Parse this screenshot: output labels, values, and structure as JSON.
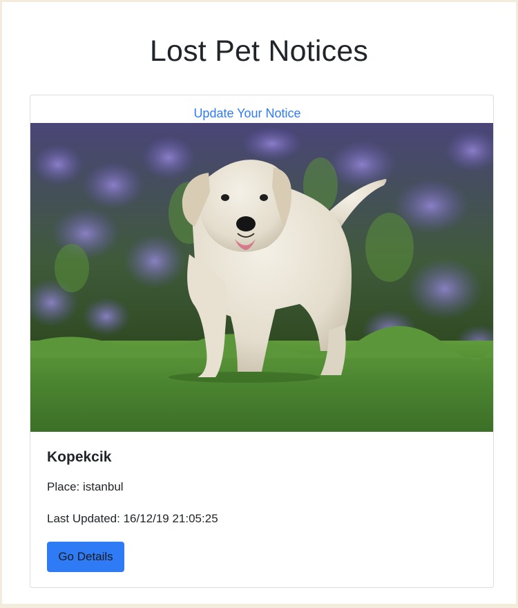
{
  "header": {
    "title": "Lost Pet Notices"
  },
  "notice_card": {
    "update_link_label": "Update Your Notice",
    "photo_alt": "Puppy on grass with flowers",
    "pet_name": "Kopekcik",
    "place_text": "Place: istanbul",
    "last_updated_text": "Last Updated: 16/12/19 21:05:25",
    "details_button_label": "Go Details"
  },
  "colors": {
    "accent": "#2f7bf5",
    "text": "#212529",
    "card_border": "#dcdcdc",
    "page_border": "#f3ecdc"
  }
}
